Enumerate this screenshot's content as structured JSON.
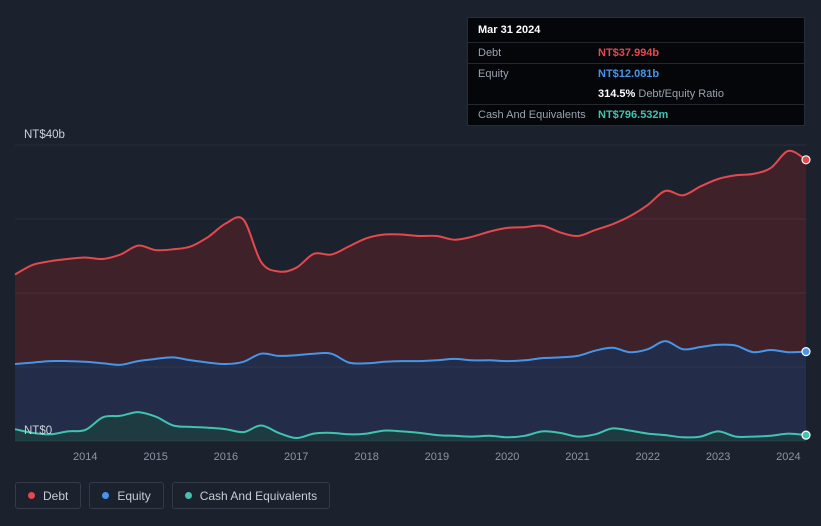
{
  "chart_data": {
    "type": "area",
    "x": [
      2013.0,
      2013.25,
      2013.5,
      2013.75,
      2014.0,
      2014.25,
      2014.5,
      2014.75,
      2015.0,
      2015.25,
      2015.5,
      2015.75,
      2016.0,
      2016.25,
      2016.5,
      2016.75,
      2017.0,
      2017.25,
      2017.5,
      2017.75,
      2018.0,
      2018.25,
      2018.5,
      2018.75,
      2019.0,
      2019.25,
      2019.5,
      2019.75,
      2020.0,
      2020.25,
      2020.5,
      2020.75,
      2021.0,
      2021.25,
      2021.5,
      2021.75,
      2022.0,
      2022.25,
      2022.5,
      2022.75,
      2023.0,
      2023.25,
      2023.5,
      2023.75,
      2024.0,
      2024.25
    ],
    "series": [
      {
        "name": "Debt",
        "color": "#e5484d",
        "fill": "#3f2129",
        "values": [
          22.5,
          23.8,
          24.3,
          24.6,
          24.8,
          24.6,
          25.2,
          26.4,
          25.8,
          25.9,
          26.3,
          27.6,
          29.4,
          29.9,
          24.2,
          22.9,
          23.4,
          25.3,
          25.2,
          26.3,
          27.4,
          27.9,
          27.9,
          27.7,
          27.7,
          27.2,
          27.6,
          28.3,
          28.8,
          28.9,
          29.1,
          28.2,
          27.7,
          28.5,
          29.3,
          30.4,
          31.9,
          33.8,
          33.2,
          34.4,
          35.4,
          35.9,
          36.1,
          36.9,
          39.2,
          37.994
        ]
      },
      {
        "name": "Equity",
        "color": "#4596eb",
        "fill": "#232c48",
        "values": [
          10.4,
          10.6,
          10.8,
          10.8,
          10.7,
          10.5,
          10.3,
          10.8,
          11.1,
          11.3,
          10.9,
          10.6,
          10.4,
          10.7,
          11.8,
          11.5,
          11.6,
          11.8,
          11.8,
          10.6,
          10.5,
          10.7,
          10.8,
          10.8,
          10.9,
          11.1,
          10.9,
          10.9,
          10.8,
          10.9,
          11.2,
          11.3,
          11.5,
          12.2,
          12.6,
          12.0,
          12.4,
          13.5,
          12.4,
          12.7,
          13.0,
          12.9,
          12.0,
          12.3,
          12.0,
          12.081
        ]
      },
      {
        "name": "Cash And Equivalents",
        "color": "#41c3b0",
        "fill": "#1d3b41",
        "values": [
          1.6,
          1.1,
          0.9,
          1.3,
          1.5,
          3.2,
          3.4,
          3.9,
          3.3,
          2.1,
          1.9,
          1.8,
          1.6,
          1.2,
          2.1,
          1.1,
          0.4,
          1.0,
          1.1,
          0.9,
          1.0,
          1.4,
          1.3,
          1.1,
          0.8,
          0.7,
          0.6,
          0.7,
          0.5,
          0.7,
          1.3,
          1.1,
          0.6,
          0.9,
          1.7,
          1.4,
          1.0,
          0.8,
          0.5,
          0.6,
          1.3,
          0.6,
          0.6,
          0.7,
          1.0,
          0.796
        ]
      }
    ],
    "xlim": [
      2013.0,
      2024.25
    ],
    "ylim": [
      0,
      40
    ],
    "y_gridlines": [
      0,
      10,
      20,
      30,
      40
    ],
    "y_axis_labels": [
      {
        "value": 40,
        "label": "NT$40b"
      },
      {
        "value": 0,
        "label": "NT$0"
      }
    ],
    "x_ticks": [
      {
        "value": 2014,
        "label": "2014"
      },
      {
        "value": 2015,
        "label": "2015"
      },
      {
        "value": 2016,
        "label": "2016"
      },
      {
        "value": 2017,
        "label": "2017"
      },
      {
        "value": 2018,
        "label": "2018"
      },
      {
        "value": 2019,
        "label": "2019"
      },
      {
        "value": 2020,
        "label": "2020"
      },
      {
        "value": 2021,
        "label": "2021"
      },
      {
        "value": 2022,
        "label": "2022"
      },
      {
        "value": 2023,
        "label": "2023"
      },
      {
        "value": 2024,
        "label": "2024"
      }
    ],
    "grid": true,
    "grid_color": "rgba(255,255,255,0.06)",
    "axis_label_color": "#ccd2da",
    "tick_label_color": "#8d95a2",
    "legend_position": "bottom-left"
  },
  "tooltip": {
    "date": "Mar 31 2024",
    "rows": {
      "debt": {
        "label": "Debt",
        "value": "NT$37.994b",
        "color": "#e5484d"
      },
      "equity": {
        "label": "Equity",
        "value": "NT$12.081b",
        "color": "#4596eb"
      },
      "ratio": {
        "value": "314.5%",
        "label": "Debt/Equity Ratio"
      },
      "cash": {
        "label": "Cash And Equivalents",
        "value": "NT$796.532m",
        "color": "#41c3b0"
      }
    }
  },
  "legend": {
    "items": [
      {
        "label": "Debt",
        "color": "#e5484d"
      },
      {
        "label": "Equity",
        "color": "#4596eb"
      },
      {
        "label": "Cash And Equivalents",
        "color": "#41c3b0"
      }
    ]
  }
}
